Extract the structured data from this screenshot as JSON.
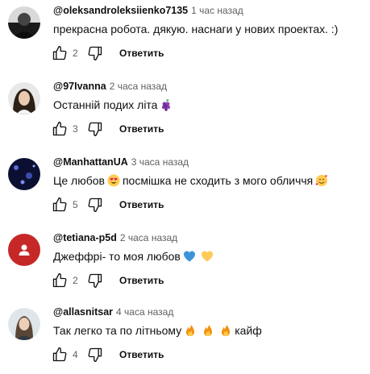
{
  "comments": [
    {
      "author": "@oleksandroleksiienko7135",
      "time": "1 час назад",
      "text": "прекрасна робота. дякую. наснаги у нових проектах. :)",
      "likes": "2",
      "reply_label": "Ответить",
      "avatar_icon": "avatar-photo-dark"
    },
    {
      "author": "@97Ivanna",
      "time": "2 часа назад",
      "text": "Останній подих літа",
      "text_suffix_icon": "grapes-emoji",
      "likes": "3",
      "reply_label": "Ответить",
      "avatar_icon": "avatar-photo-woman"
    },
    {
      "author": "@ManhattanUA",
      "time": "3 часа назад",
      "text_part1": "Це любов",
      "text_part2": "посмішка не сходить з мого обличчя",
      "likes": "5",
      "reply_label": "Ответить",
      "avatar_icon": "avatar-photo-night"
    },
    {
      "author": "@tetiana-p5d",
      "time": "2 часа назад",
      "text": "Джеффрі- то моя любов",
      "likes": "2",
      "reply_label": "Ответить",
      "avatar_icon": "avatar-default-user",
      "avatar_color": "#c62828"
    },
    {
      "author": "@allasnitsar",
      "time": "4 часа назад",
      "text_part1": "Так легко та по літньому",
      "text_part2": "кайф",
      "likes": "4",
      "reply_label": "Ответить",
      "avatar_icon": "avatar-photo-woman-light"
    }
  ]
}
